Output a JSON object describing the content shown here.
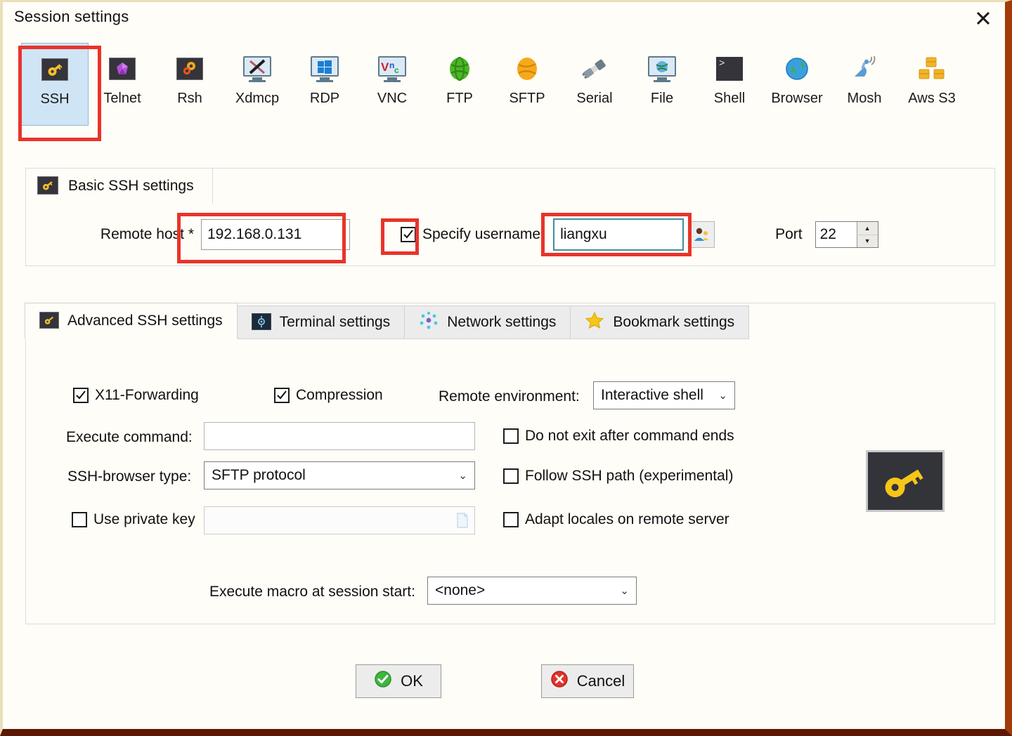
{
  "window": {
    "title": "Session settings",
    "close_label": "×",
    "close_icon": "close-icon",
    "frame_accent": "#a33a08",
    "annotation_color": "#e8342a"
  },
  "protocols": {
    "selected": "SSH",
    "items": [
      {
        "label": "SSH",
        "icon": "key-icon"
      },
      {
        "label": "Telnet",
        "icon": "crystal-icon"
      },
      {
        "label": "Rsh",
        "icon": "gears-icon"
      },
      {
        "label": "Xdmcp",
        "icon": "x-monitor-icon"
      },
      {
        "label": "RDP",
        "icon": "windows-monitor-icon"
      },
      {
        "label": "VNC",
        "icon": "vnc-monitor-icon"
      },
      {
        "label": "FTP",
        "icon": "green-globe-icon"
      },
      {
        "label": "SFTP",
        "icon": "orange-globe-icon"
      },
      {
        "label": "Serial",
        "icon": "plug-icon"
      },
      {
        "label": "File",
        "icon": "file-monitor-icon"
      },
      {
        "label": "Shell",
        "icon": "terminal-icon"
      },
      {
        "label": "Browser",
        "icon": "blue-globe-icon"
      },
      {
        "label": "Mosh",
        "icon": "satellite-icon"
      },
      {
        "label": "Aws S3",
        "icon": "aws-boxes-icon"
      }
    ]
  },
  "basic": {
    "legend": "Basic SSH settings",
    "legend_icon": "key-icon",
    "remote_host_label": "Remote host *",
    "remote_host_value": "192.168.0.131",
    "specify_username_label": "Specify username",
    "specify_username_checked": true,
    "username_value": "liangxu",
    "username_picker_icon": "user-icon",
    "port_label": "Port",
    "port_value": "22",
    "spin_up_icon": "chevron-up-icon",
    "spin_down_icon": "chevron-down-icon"
  },
  "tabs": [
    {
      "label": "Advanced SSH settings",
      "icon": "key-icon",
      "active": true
    },
    {
      "label": "Terminal settings",
      "icon": "terminal-settings-icon",
      "active": false
    },
    {
      "label": "Network settings",
      "icon": "network-icon",
      "active": false
    },
    {
      "label": "Bookmark settings",
      "icon": "star-icon",
      "active": false
    }
  ],
  "advanced": {
    "x11_forwarding_label": "X11-Forwarding",
    "x11_forwarding_checked": true,
    "compression_label": "Compression",
    "compression_checked": true,
    "remote_environment_label": "Remote environment:",
    "remote_environment_value": "Interactive shell",
    "execute_command_label": "Execute command:",
    "execute_command_value": "",
    "do_not_exit_label": "Do not exit after command ends",
    "do_not_exit_checked": false,
    "ssh_browser_label": "SSH-browser type:",
    "ssh_browser_value": "SFTP protocol",
    "follow_ssh_path_label": "Follow SSH path (experimental)",
    "follow_ssh_path_checked": false,
    "use_private_key_label": "Use private key",
    "use_private_key_checked": false,
    "private_key_value": "",
    "private_key_browse_icon": "document-icon",
    "adapt_locales_label": "Adapt locales on remote server",
    "adapt_locales_checked": false,
    "execute_macro_label": "Execute macro at session start:",
    "execute_macro_value": "<none>",
    "side_icon": "big-key-icon",
    "dropdown_icon": "chevron-down-icon"
  },
  "footer": {
    "ok_label": "OK",
    "ok_icon": "green-check-icon",
    "cancel_label": "Cancel",
    "cancel_icon": "red-x-icon"
  }
}
